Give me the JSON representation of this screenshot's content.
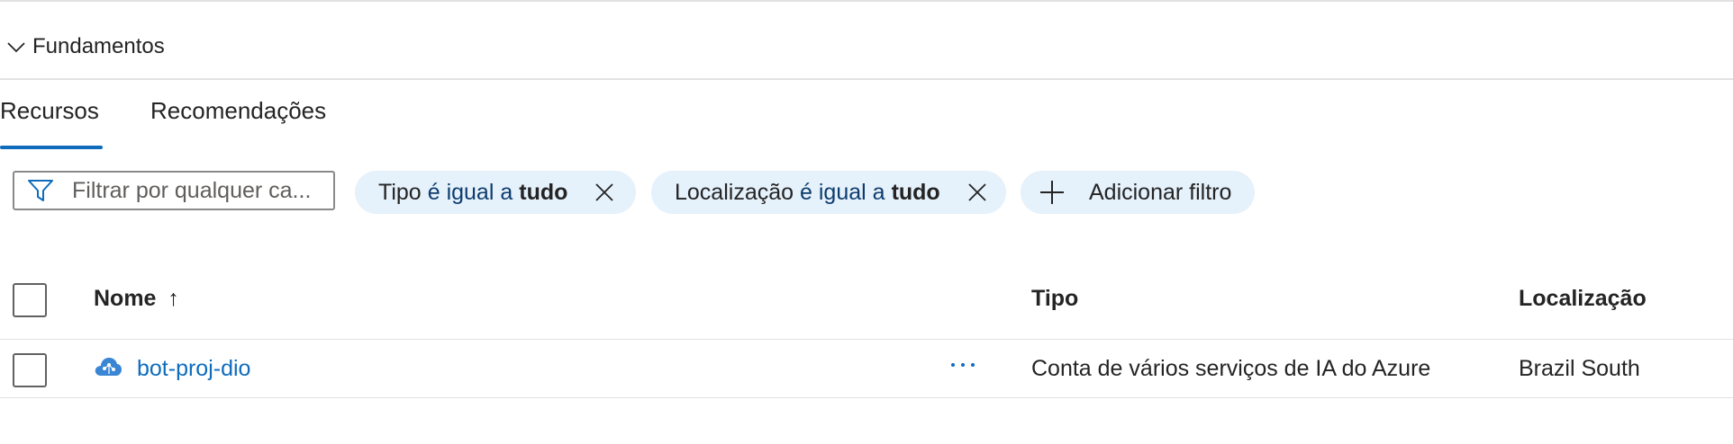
{
  "section": {
    "label": "Fundamentos"
  },
  "tabs": [
    {
      "label": "Recursos",
      "active": true
    },
    {
      "label": "Recomendações",
      "active": false
    }
  ],
  "filter": {
    "placeholder": "Filtrar por qualquer ca..."
  },
  "pills": [
    {
      "field": "Tipo",
      "operator": "é igual a",
      "value": "tudo"
    },
    {
      "field": "Localização",
      "operator": "é igual a",
      "value": "tudo"
    }
  ],
  "add_filter": {
    "label": "Adicionar filtro"
  },
  "table": {
    "headers": {
      "name": "Nome",
      "sort_indicator": "↑",
      "type": "Tipo",
      "location": "Localização"
    },
    "rows": [
      {
        "name": "bot-proj-dio",
        "type": "Conta de vários serviços de IA do Azure",
        "location": "Brazil South",
        "icon": "cognitive-services-icon"
      }
    ]
  },
  "colors": {
    "accent": "#0f6cbd",
    "pill_bg": "#e5f1fb",
    "divider": "#e1e1e1"
  }
}
